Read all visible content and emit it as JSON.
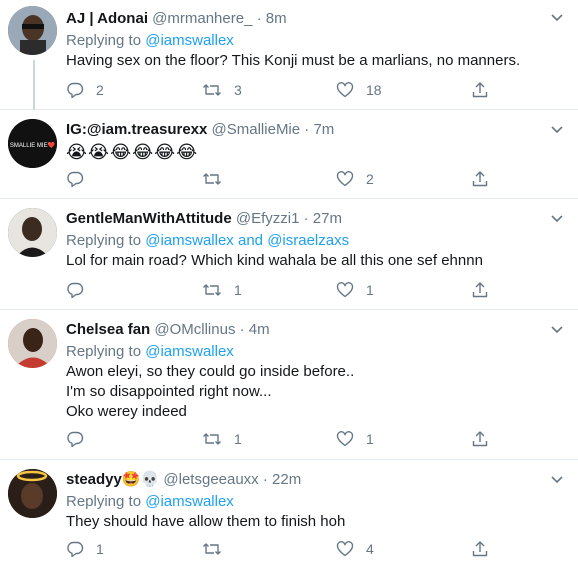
{
  "tweets": [
    {
      "name": "AJ | Adonai",
      "handle": "@mrmanhere_",
      "dot": "·",
      "time": "8m",
      "replying_prefix": "Replying to",
      "replying_to": "@iamswallex",
      "replying_conj": "",
      "replying_to2": "",
      "text": "Having sex on the floor? This Konji must be a marlians, no manners.",
      "replies": "2",
      "retweets": "3",
      "likes": "18",
      "avatar_color": "#5a4636"
    },
    {
      "name": "IG:@iam.treasurexx",
      "handle": "@SmallieMie",
      "dot": "·",
      "time": "7m",
      "replying_prefix": "",
      "replying_to": "",
      "replying_conj": "",
      "replying_to2": "",
      "text": "😭😭😂😂😂😂",
      "replies": "",
      "retweets": "",
      "likes": "2",
      "avatar_label": "SMALLIE MIE❤️",
      "avatar_color": "#111111"
    },
    {
      "name": "GentleManWithAttitude",
      "handle": "@Efyzzi1",
      "dot": "·",
      "time": "27m",
      "replying_prefix": "Replying to",
      "replying_to": "@iamswallex",
      "replying_conj": "and",
      "replying_to2": "@israelzaxs",
      "text": "Lol for main road? Which kind wahala be all this one sef ehnnn",
      "replies": "",
      "retweets": "1",
      "likes": "1",
      "avatar_color": "#2b2622"
    },
    {
      "name": "Chelsea fan",
      "handle": "@OMcllinus",
      "dot": "·",
      "time": "4m",
      "replying_prefix": "Replying to",
      "replying_to": "@iamswallex",
      "replying_conj": "",
      "replying_to2": "",
      "text": "Awon eleyi, so they could go inside before..\nI'm so disappointed right now...\nOko werey indeed",
      "replies": "",
      "retweets": "1",
      "likes": "1",
      "avatar_color": "#c43b2f"
    },
    {
      "name": "steadyy",
      "name_emojis": "🤩💀",
      "handle": "@letsgeeauxx",
      "dot": "·",
      "time": "22m",
      "replying_prefix": "Replying to",
      "replying_to": "@iamswallex",
      "replying_conj": "",
      "replying_to2": "",
      "text": "They should have allow them to finish hoh",
      "replies": "1",
      "retweets": "",
      "likes": "4",
      "avatar_color": "#3a2a22"
    }
  ],
  "colors": {
    "accent": "#1da1f2",
    "muted": "#657786",
    "text": "#14171a",
    "border": "#e6ecf0"
  },
  "icons": [
    "reply-icon",
    "retweet-icon",
    "like-icon",
    "share-icon",
    "more-icon"
  ]
}
